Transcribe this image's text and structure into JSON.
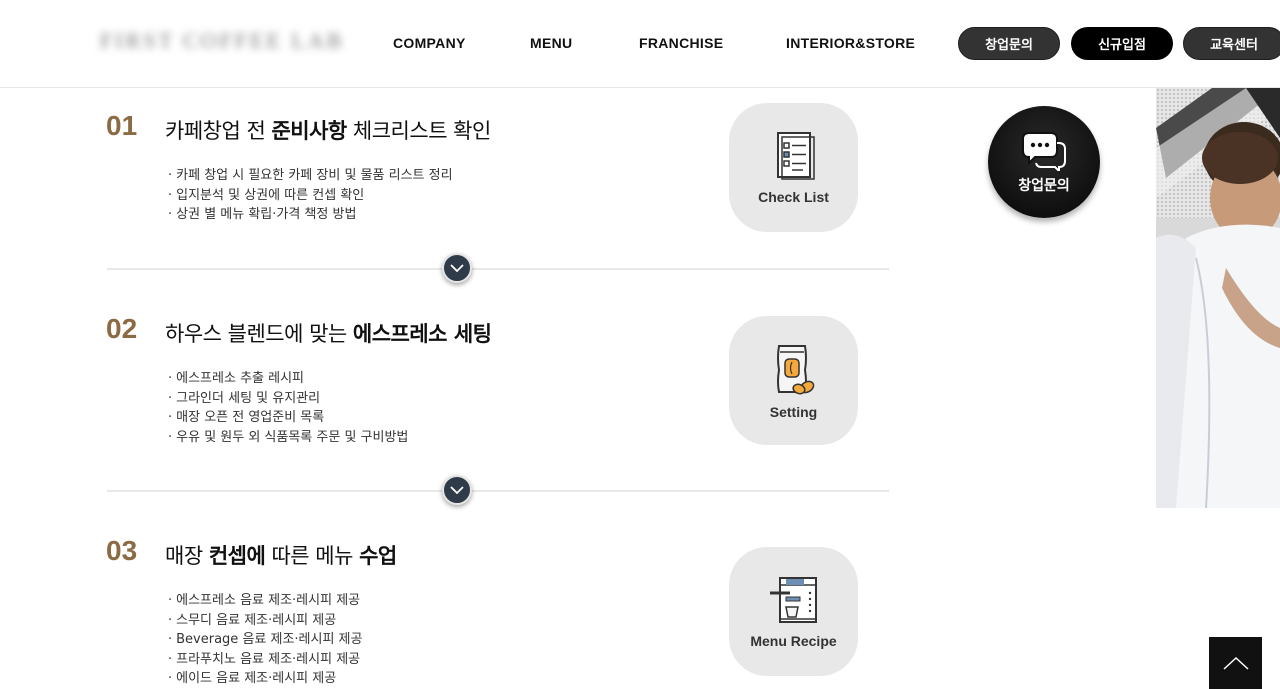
{
  "header": {
    "logo_text": "FIRST COFFEE LAB",
    "nav": [
      "COMPANY",
      "MENU",
      "FRANCHISE",
      "INTERIOR&STORE"
    ],
    "buttons": [
      "창업문의",
      "신규입점",
      "교육센터"
    ]
  },
  "sections": [
    {
      "number": "01",
      "title_light_1": "카페창업 전 ",
      "title_bold": "준비사항",
      "title_light_2": " 체크리스트 확인",
      "bullets": [
        "카페 창업 시 필요한 카페 장비 및 물품 리스트 정리",
        "입지분석 및 상권에 따른 컨셉 확인",
        "상권 별 메뉴 확립·가격 책정 방법"
      ],
      "card_label": "Check List",
      "card_icon": "checklist-icon"
    },
    {
      "number": "02",
      "title_light_1": "하우스 블렌드에 맞는 ",
      "title_bold": "에스프레소 세팅",
      "title_light_2": "",
      "bullets": [
        "에스프레소 추출 레시피",
        "그라인더 세팅 및 유지관리",
        "매장 오픈 전 영업준비 목록",
        "우유 및 원두 외 식품목록 주문 및 구비방법"
      ],
      "card_label": "Setting",
      "card_icon": "coffee-bag-icon"
    },
    {
      "number": "03",
      "title_light_1": "매장 ",
      "title_bold": "컨셉에",
      "title_light_2": " 따른 메뉴 ",
      "title_bold_2": "수업",
      "bullets": [
        "에스프레소 음료 제조·레시피 제공",
        "스무디 음료 제조·레시피 제공",
        "Beverage 음료 제조·레시피 제공",
        "프라푸치노 음료 제조·레시피 제공",
        "에이드 음료 제조·레시피 제공"
      ],
      "card_label": "Menu Recipe",
      "card_icon": "espresso-machine-icon"
    }
  ],
  "floating": {
    "consult_label": "창업문의",
    "icon": "chat-bubble-icon"
  },
  "colors": {
    "accent": "#8c6a43",
    "dark": "#2f3b48",
    "card_bg": "#e8e8e8"
  }
}
